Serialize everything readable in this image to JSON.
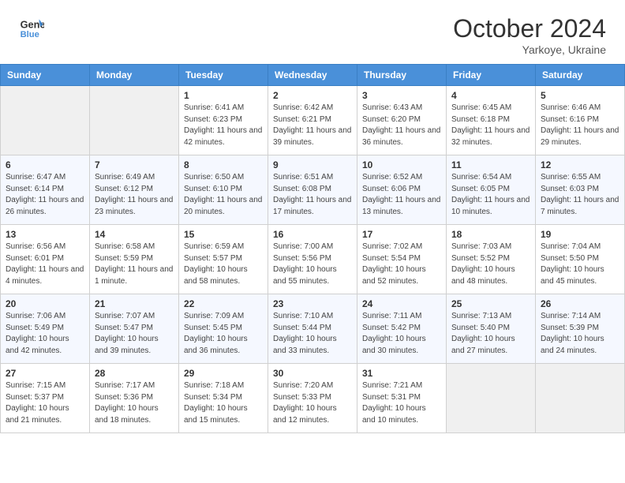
{
  "header": {
    "logo_line1": "General",
    "logo_line2": "Blue",
    "month": "October 2024",
    "location": "Yarkoye, Ukraine"
  },
  "weekdays": [
    "Sunday",
    "Monday",
    "Tuesday",
    "Wednesday",
    "Thursday",
    "Friday",
    "Saturday"
  ],
  "weeks": [
    [
      {
        "day": "",
        "sunrise": "",
        "sunset": "",
        "daylight": ""
      },
      {
        "day": "",
        "sunrise": "",
        "sunset": "",
        "daylight": ""
      },
      {
        "day": "1",
        "sunrise": "Sunrise: 6:41 AM",
        "sunset": "Sunset: 6:23 PM",
        "daylight": "Daylight: 11 hours and 42 minutes."
      },
      {
        "day": "2",
        "sunrise": "Sunrise: 6:42 AM",
        "sunset": "Sunset: 6:21 PM",
        "daylight": "Daylight: 11 hours and 39 minutes."
      },
      {
        "day": "3",
        "sunrise": "Sunrise: 6:43 AM",
        "sunset": "Sunset: 6:20 PM",
        "daylight": "Daylight: 11 hours and 36 minutes."
      },
      {
        "day": "4",
        "sunrise": "Sunrise: 6:45 AM",
        "sunset": "Sunset: 6:18 PM",
        "daylight": "Daylight: 11 hours and 32 minutes."
      },
      {
        "day": "5",
        "sunrise": "Sunrise: 6:46 AM",
        "sunset": "Sunset: 6:16 PM",
        "daylight": "Daylight: 11 hours and 29 minutes."
      }
    ],
    [
      {
        "day": "6",
        "sunrise": "Sunrise: 6:47 AM",
        "sunset": "Sunset: 6:14 PM",
        "daylight": "Daylight: 11 hours and 26 minutes."
      },
      {
        "day": "7",
        "sunrise": "Sunrise: 6:49 AM",
        "sunset": "Sunset: 6:12 PM",
        "daylight": "Daylight: 11 hours and 23 minutes."
      },
      {
        "day": "8",
        "sunrise": "Sunrise: 6:50 AM",
        "sunset": "Sunset: 6:10 PM",
        "daylight": "Daylight: 11 hours and 20 minutes."
      },
      {
        "day": "9",
        "sunrise": "Sunrise: 6:51 AM",
        "sunset": "Sunset: 6:08 PM",
        "daylight": "Daylight: 11 hours and 17 minutes."
      },
      {
        "day": "10",
        "sunrise": "Sunrise: 6:52 AM",
        "sunset": "Sunset: 6:06 PM",
        "daylight": "Daylight: 11 hours and 13 minutes."
      },
      {
        "day": "11",
        "sunrise": "Sunrise: 6:54 AM",
        "sunset": "Sunset: 6:05 PM",
        "daylight": "Daylight: 11 hours and 10 minutes."
      },
      {
        "day": "12",
        "sunrise": "Sunrise: 6:55 AM",
        "sunset": "Sunset: 6:03 PM",
        "daylight": "Daylight: 11 hours and 7 minutes."
      }
    ],
    [
      {
        "day": "13",
        "sunrise": "Sunrise: 6:56 AM",
        "sunset": "Sunset: 6:01 PM",
        "daylight": "Daylight: 11 hours and 4 minutes."
      },
      {
        "day": "14",
        "sunrise": "Sunrise: 6:58 AM",
        "sunset": "Sunset: 5:59 PM",
        "daylight": "Daylight: 11 hours and 1 minute."
      },
      {
        "day": "15",
        "sunrise": "Sunrise: 6:59 AM",
        "sunset": "Sunset: 5:57 PM",
        "daylight": "Daylight: 10 hours and 58 minutes."
      },
      {
        "day": "16",
        "sunrise": "Sunrise: 7:00 AM",
        "sunset": "Sunset: 5:56 PM",
        "daylight": "Daylight: 10 hours and 55 minutes."
      },
      {
        "day": "17",
        "sunrise": "Sunrise: 7:02 AM",
        "sunset": "Sunset: 5:54 PM",
        "daylight": "Daylight: 10 hours and 52 minutes."
      },
      {
        "day": "18",
        "sunrise": "Sunrise: 7:03 AM",
        "sunset": "Sunset: 5:52 PM",
        "daylight": "Daylight: 10 hours and 48 minutes."
      },
      {
        "day": "19",
        "sunrise": "Sunrise: 7:04 AM",
        "sunset": "Sunset: 5:50 PM",
        "daylight": "Daylight: 10 hours and 45 minutes."
      }
    ],
    [
      {
        "day": "20",
        "sunrise": "Sunrise: 7:06 AM",
        "sunset": "Sunset: 5:49 PM",
        "daylight": "Daylight: 10 hours and 42 minutes."
      },
      {
        "day": "21",
        "sunrise": "Sunrise: 7:07 AM",
        "sunset": "Sunset: 5:47 PM",
        "daylight": "Daylight: 10 hours and 39 minutes."
      },
      {
        "day": "22",
        "sunrise": "Sunrise: 7:09 AM",
        "sunset": "Sunset: 5:45 PM",
        "daylight": "Daylight: 10 hours and 36 minutes."
      },
      {
        "day": "23",
        "sunrise": "Sunrise: 7:10 AM",
        "sunset": "Sunset: 5:44 PM",
        "daylight": "Daylight: 10 hours and 33 minutes."
      },
      {
        "day": "24",
        "sunrise": "Sunrise: 7:11 AM",
        "sunset": "Sunset: 5:42 PM",
        "daylight": "Daylight: 10 hours and 30 minutes."
      },
      {
        "day": "25",
        "sunrise": "Sunrise: 7:13 AM",
        "sunset": "Sunset: 5:40 PM",
        "daylight": "Daylight: 10 hours and 27 minutes."
      },
      {
        "day": "26",
        "sunrise": "Sunrise: 7:14 AM",
        "sunset": "Sunset: 5:39 PM",
        "daylight": "Daylight: 10 hours and 24 minutes."
      }
    ],
    [
      {
        "day": "27",
        "sunrise": "Sunrise: 7:15 AM",
        "sunset": "Sunset: 5:37 PM",
        "daylight": "Daylight: 10 hours and 21 minutes."
      },
      {
        "day": "28",
        "sunrise": "Sunrise: 7:17 AM",
        "sunset": "Sunset: 5:36 PM",
        "daylight": "Daylight: 10 hours and 18 minutes."
      },
      {
        "day": "29",
        "sunrise": "Sunrise: 7:18 AM",
        "sunset": "Sunset: 5:34 PM",
        "daylight": "Daylight: 10 hours and 15 minutes."
      },
      {
        "day": "30",
        "sunrise": "Sunrise: 7:20 AM",
        "sunset": "Sunset: 5:33 PM",
        "daylight": "Daylight: 10 hours and 12 minutes."
      },
      {
        "day": "31",
        "sunrise": "Sunrise: 7:21 AM",
        "sunset": "Sunset: 5:31 PM",
        "daylight": "Daylight: 10 hours and 10 minutes."
      },
      {
        "day": "",
        "sunrise": "",
        "sunset": "",
        "daylight": ""
      },
      {
        "day": "",
        "sunrise": "",
        "sunset": "",
        "daylight": ""
      }
    ]
  ]
}
